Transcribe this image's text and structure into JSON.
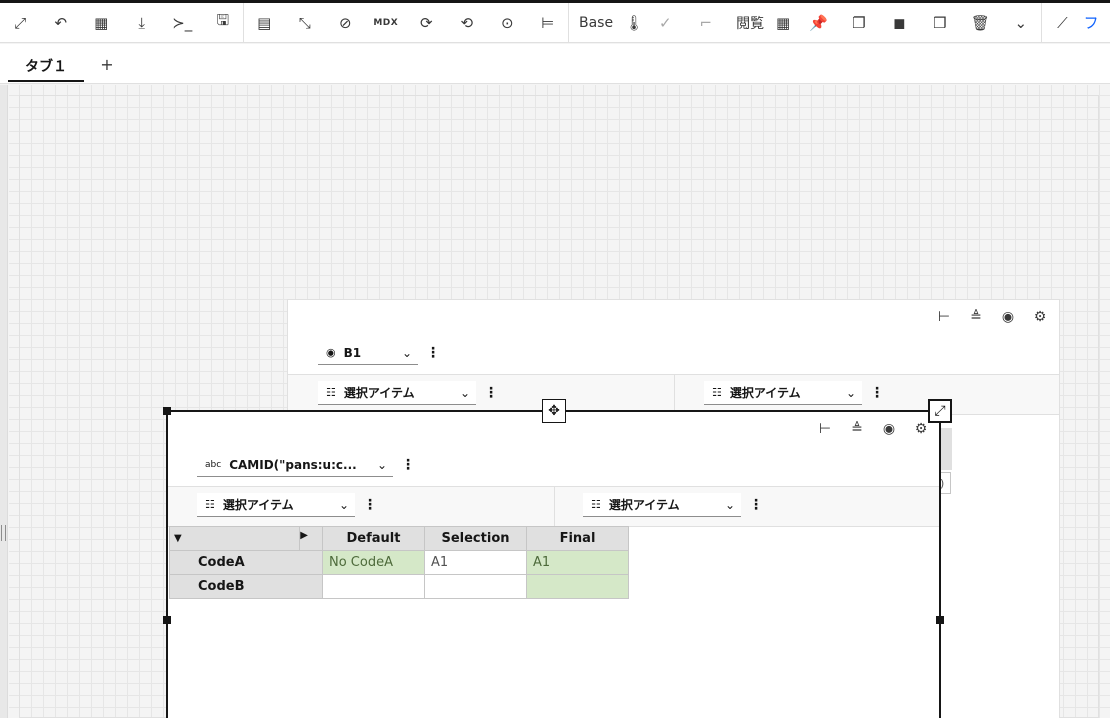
{
  "toolbar": {
    "icons": [
      {
        "name": "fit-screen-icon",
        "glyph": "⤢"
      },
      {
        "name": "undo-icon",
        "glyph": "↶"
      },
      {
        "name": "crosstab-icon",
        "glyph": "▦"
      },
      {
        "name": "download-icon",
        "glyph": "⤓"
      },
      {
        "name": "terminal-icon",
        "glyph": "≻_"
      },
      {
        "name": "save-icon",
        "glyph": "🖫"
      },
      {
        "name": "table-icon",
        "glyph": "▤"
      },
      {
        "name": "resize-icon",
        "glyph": "⤡"
      },
      {
        "name": "hide-icon",
        "glyph": "⊘"
      },
      {
        "name": "mdx-icon",
        "glyph": "MDX"
      },
      {
        "name": "refresh-icon",
        "glyph": "⟳"
      },
      {
        "name": "refresh-settings-icon",
        "glyph": "⟲"
      },
      {
        "name": "focus-icon",
        "glyph": "⊙"
      },
      {
        "name": "hierarchy-icon",
        "glyph": "⊨"
      }
    ],
    "base_label": "Base",
    "icons2": [
      {
        "name": "thermometer-icon",
        "glyph": "🌡"
      },
      {
        "name": "check-circle-icon",
        "glyph": "✓"
      },
      {
        "name": "corner-icon",
        "glyph": "⌐"
      }
    ],
    "browse_label": "閲覧",
    "icons3": [
      {
        "name": "grid-icon",
        "glyph": "▦"
      },
      {
        "name": "pin-icon",
        "glyph": "📌"
      },
      {
        "name": "copy-icon",
        "glyph": "❐"
      },
      {
        "name": "bring-front-icon",
        "glyph": "◼"
      },
      {
        "name": "send-back-icon",
        "glyph": "❒"
      },
      {
        "name": "delete-icon",
        "glyph": "🗑"
      },
      {
        "name": "chevron-down-icon",
        "glyph": "⌄"
      },
      {
        "name": "chart-icon",
        "glyph": "⟋"
      }
    ],
    "more_glyph": "フ"
  },
  "tabs": {
    "items": [
      {
        "label": "タブ１"
      }
    ],
    "add_label": "+"
  },
  "back_widget": {
    "icons": [
      {
        "name": "hierarchy-tree-icon",
        "glyph": "⊢"
      },
      {
        "name": "align-icon",
        "glyph": "≜"
      },
      {
        "name": "eye-icon",
        "glyph": "◉"
      },
      {
        "name": "gear-icon",
        "glyph": "⚙"
      }
    ],
    "dimension_selector": {
      "label": "B1",
      "icon": "◉"
    },
    "row_selector": {
      "label": "選択アイテム"
    },
    "col_selector": {
      "label": "選択アイテム"
    },
    "partial_value": ")"
  },
  "front_widget": {
    "icons": [
      {
        "name": "hierarchy-tree-icon",
        "glyph": "⊢"
      },
      {
        "name": "align-icon",
        "glyph": "≜"
      },
      {
        "name": "eye-icon",
        "glyph": "◉"
      },
      {
        "name": "gear-icon",
        "glyph": "⚙"
      }
    ],
    "dimension_selector": {
      "label": "CAMID(\"pans:u:c...",
      "icon": "abc"
    },
    "row_selector": {
      "label": "選択アイテム"
    },
    "col_selector": {
      "label": "選択アイテム"
    },
    "table": {
      "columns": [
        "Default",
        "Selection",
        "Final"
      ],
      "rows": [
        {
          "label": "CodeA",
          "cells": [
            "No CodeA",
            "A1",
            "A1"
          ]
        },
        {
          "label": "CodeB",
          "cells": [
            "",
            "",
            ""
          ]
        }
      ]
    }
  },
  "glyphs": {
    "chevron": "⌄",
    "kebab": "⋮",
    "list_icon": "☷",
    "move": "✥",
    "expand": "⤢",
    "tri_down": "▼",
    "tri_right": "▶"
  }
}
